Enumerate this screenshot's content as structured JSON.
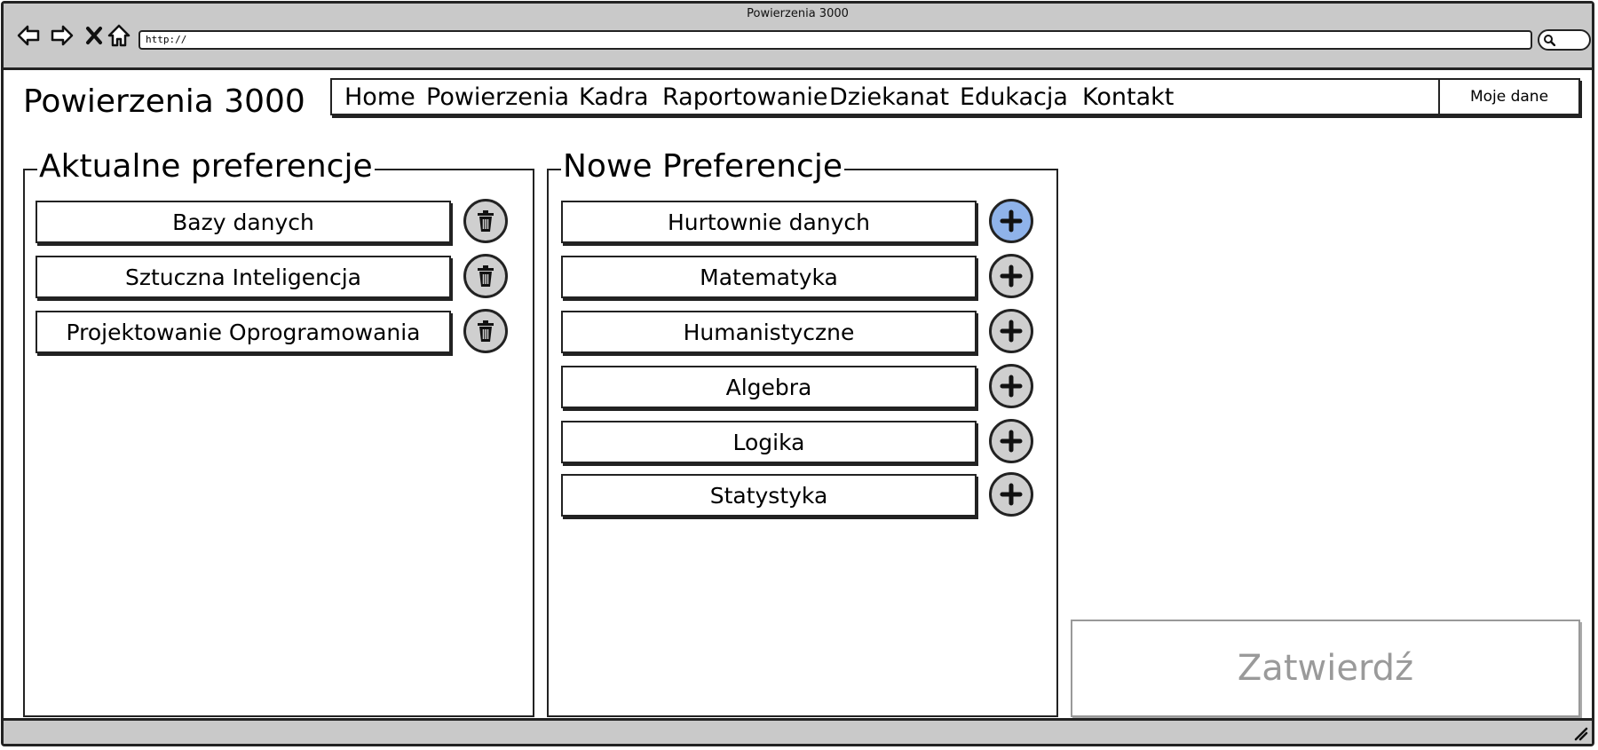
{
  "window": {
    "title": "Powierzenia 3000",
    "url": "http://"
  },
  "icons": {
    "back": "arrow-left-icon",
    "forward": "arrow-right-icon",
    "stop": "close-icon",
    "home": "home-icon",
    "search": "search-icon",
    "remove": "trash-icon",
    "add": "plus-icon"
  },
  "header": {
    "app_title": "Powierzenia 3000",
    "menu": [
      "Home",
      "Powierzenia",
      "Kadra",
      "Raportowanie",
      "Dziekanat",
      "Edukacja",
      "Kontakt"
    ],
    "account_button": "Moje dane"
  },
  "current": {
    "title": "Aktualne preferencje",
    "items": [
      "Bazy danych",
      "Sztuczna Inteligencja",
      "Projektowanie Oprogramowania"
    ]
  },
  "new": {
    "title": "Nowe Preferencje",
    "items": [
      "Hurtownie danych",
      "Matematyka",
      "Humanistyczne",
      "Algebra",
      "Logika",
      "Statystyka"
    ]
  },
  "confirm_button": "Zatwierdź",
  "colors": {
    "active_add_button": "#8fb3ea",
    "inactive_button": "#cfcfcf",
    "chrome": "#c9c9c9",
    "disabled_text": "#9a9a9a"
  }
}
